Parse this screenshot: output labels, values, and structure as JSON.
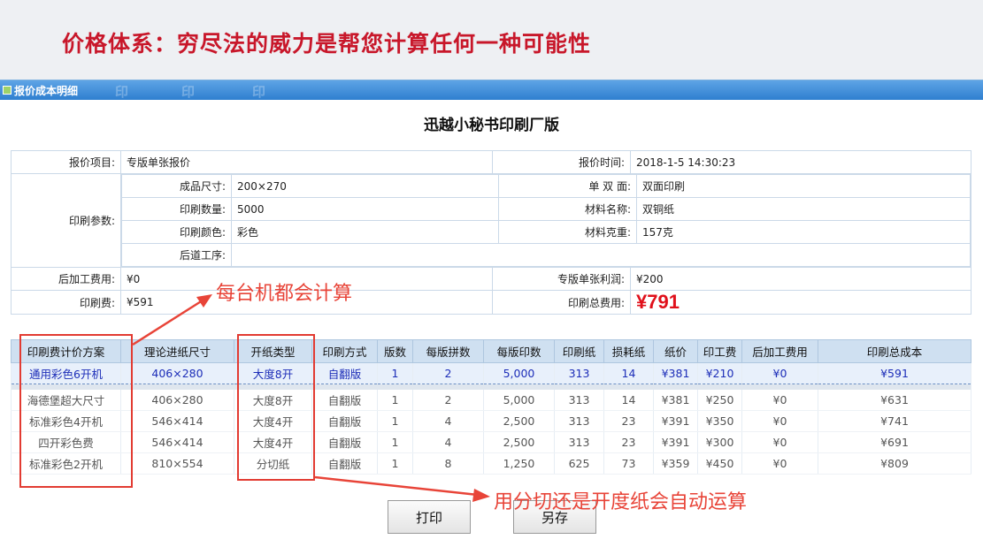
{
  "slide": {
    "title": "价格体系：穷尽法的威力是帮您计算任何一种可能性"
  },
  "window": {
    "title": "报价成本明细",
    "watermark": "印"
  },
  "report": {
    "title": "迅越小秘书印刷厂版"
  },
  "info": {
    "item_label": "报价项目:",
    "item_value": "专版单张报价",
    "time_label": "报价时间:",
    "time_value": "2018-1-5 14:30:23",
    "params_label": "印刷参数:",
    "size_label": "成品尺寸:",
    "size_value": "200×270",
    "sides_label": "单 双 面:",
    "sides_value": "双面印刷",
    "qty_label": "印刷数量:",
    "qty_value": "5000",
    "material_label": "材料名称:",
    "material_value": "双铜纸",
    "color_label": "印刷颜色:",
    "color_value": "彩色",
    "weight_label": "材料克重:",
    "weight_value": "157克",
    "post_label": "后道工序:",
    "post_value": "",
    "postfee_label": "后加工费用:",
    "postfee_value": "¥0",
    "profit_label": "专版单张利润:",
    "profit_value": "¥200",
    "printfee_label": "印刷费:",
    "printfee_value": "¥591",
    "total_label": "印刷总费用:",
    "total_value": "¥791"
  },
  "calc": {
    "headers": [
      "印刷费计价方案",
      "理论进纸尺寸",
      "开纸类型",
      "印刷方式",
      "版数",
      "每版拼数",
      "每版印数",
      "印刷纸",
      "损耗纸",
      "纸价",
      "印工费",
      "后加工费用",
      "印刷总成本"
    ],
    "best": [
      "通用彩色6开机",
      "406×280",
      "大度8开",
      "自翻版",
      "1",
      "2",
      "5,000",
      "313",
      "14",
      "¥381",
      "¥210",
      "¥0",
      "¥591"
    ],
    "rows": [
      [
        "海德堡超大尺寸",
        "406×280",
        "大度8开",
        "自翻版",
        "1",
        "2",
        "5,000",
        "313",
        "14",
        "¥381",
        "¥250",
        "¥0",
        "¥631"
      ],
      [
        "标准彩色4开机",
        "546×414",
        "大度4开",
        "自翻版",
        "1",
        "4",
        "2,500",
        "313",
        "23",
        "¥391",
        "¥350",
        "¥0",
        "¥741"
      ],
      [
        "四开彩色费",
        "546×414",
        "大度4开",
        "自翻版",
        "1",
        "4",
        "2,500",
        "313",
        "23",
        "¥391",
        "¥300",
        "¥0",
        "¥691"
      ],
      [
        "标准彩色2开机",
        "810×554",
        "分切纸",
        "自翻版",
        "1",
        "8",
        "1,250",
        "625",
        "73",
        "¥359",
        "¥450",
        "¥0",
        "¥809"
      ]
    ]
  },
  "buttons": {
    "print": "打印",
    "save": "另存"
  },
  "annotations": {
    "machines": "每台机都会计算",
    "paper": "用分切还是开度纸会自动运算"
  },
  "colors": {
    "title_red": "#c8172a",
    "annot_red": "#e84438",
    "best_row_blue": "#1c2db8",
    "header_bg": "#cfe0f1"
  }
}
